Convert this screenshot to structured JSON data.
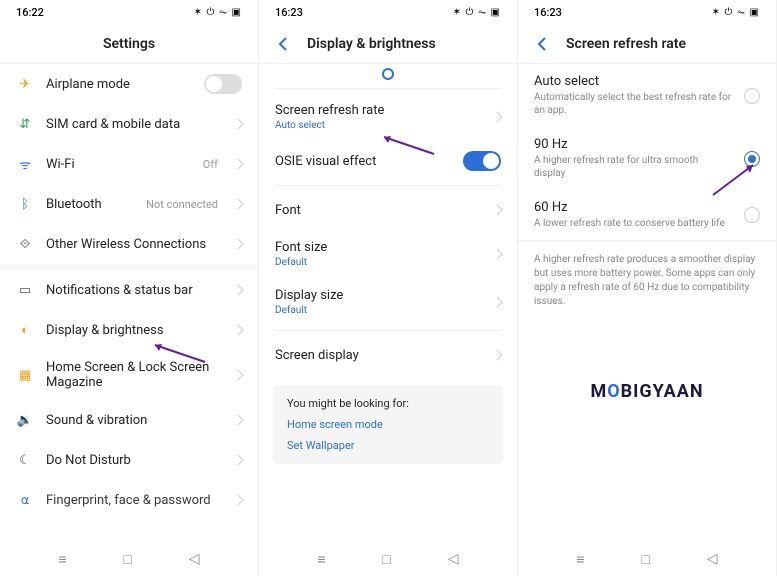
{
  "status": {
    "time1": "16:22",
    "time2": "16:23",
    "time3": "16:23",
    "icons": "✶ ⏻ ⏦ ▣"
  },
  "screen1": {
    "title": "Settings",
    "items": [
      {
        "label": "Airplane mode",
        "icon": "airplane",
        "toggle": "off"
      },
      {
        "label": "SIM card & mobile data",
        "icon": "sim",
        "chevron": true
      },
      {
        "label": "Wi-Fi",
        "icon": "wifi",
        "right": "Off",
        "chevron": true
      },
      {
        "label": "Bluetooth",
        "icon": "bt",
        "right": "Not connected",
        "chevron": true
      },
      {
        "label": "Other Wireless Connections",
        "icon": "chain",
        "chevron": true
      }
    ],
    "items2": [
      {
        "label": "Notifications & status bar",
        "icon": "notif",
        "chevron": true
      },
      {
        "label": "Display & brightness",
        "icon": "bright",
        "chevron": true
      },
      {
        "label": "Home Screen & Lock Screen Magazine",
        "icon": "home",
        "chevron": true
      },
      {
        "label": "Sound & vibration",
        "icon": "sound",
        "chevron": true
      },
      {
        "label": "Do Not Disturb",
        "icon": "dnd",
        "chevron": true
      },
      {
        "label": "Fingerprint, face & password",
        "icon": "finger",
        "chevron": true
      }
    ]
  },
  "screen2": {
    "title": "Display & brightness",
    "rows": {
      "refresh": {
        "label": "Screen refresh rate",
        "sub": "Auto select"
      },
      "osie": {
        "label": "OSIE visual effect"
      },
      "font": {
        "label": "Font"
      },
      "fontsize": {
        "label": "Font size",
        "sub": "Default"
      },
      "dispsize": {
        "label": "Display size",
        "sub": "Default"
      },
      "screend": {
        "label": "Screen display"
      }
    },
    "suggest": {
      "title": "You might be looking for:",
      "link1": "Home screen mode",
      "link2": "Set Wallpaper"
    }
  },
  "screen3": {
    "title": "Screen refresh rate",
    "options": [
      {
        "label": "Auto select",
        "desc": "Automatically select the best refresh rate for an app.",
        "selected": false
      },
      {
        "label": "90 Hz",
        "desc": "A higher refresh rate for ultra smooth display",
        "selected": true
      },
      {
        "label": "60 Hz",
        "desc": "A lower refresh rate to conserve battery life",
        "selected": false
      }
    ],
    "note": "A higher refresh rate produces a smoother display but uses more battery power. Some apps can only apply a refresh rate of 60 Hz due to compatibility issues."
  },
  "logo": {
    "m": "M",
    "o": "O",
    "rest": "BIGYAAN"
  },
  "nav": {
    "recent": "≡",
    "home": "□",
    "back": "◁"
  },
  "icons": {
    "airplane": "✈",
    "sim": "⇵",
    "wifi": "ᯤ",
    "bt": "ᛒ",
    "chain": "⟐",
    "notif": "▭",
    "bright": "◐",
    "home": "▦",
    "sound": "🔉",
    "dnd": "☾",
    "finger": "⍺"
  },
  "iconColors": {
    "airplane": "#f0a020",
    "sim": "#2e9b4f",
    "wifi": "#2d6fd5",
    "bt": "#2d6fd5",
    "chain": "#555",
    "notif": "#555",
    "bright": "#f0a020",
    "home": "#f0a020",
    "sound": "#2e9b4f",
    "dnd": "#555",
    "finger": "#2d6fd5"
  }
}
